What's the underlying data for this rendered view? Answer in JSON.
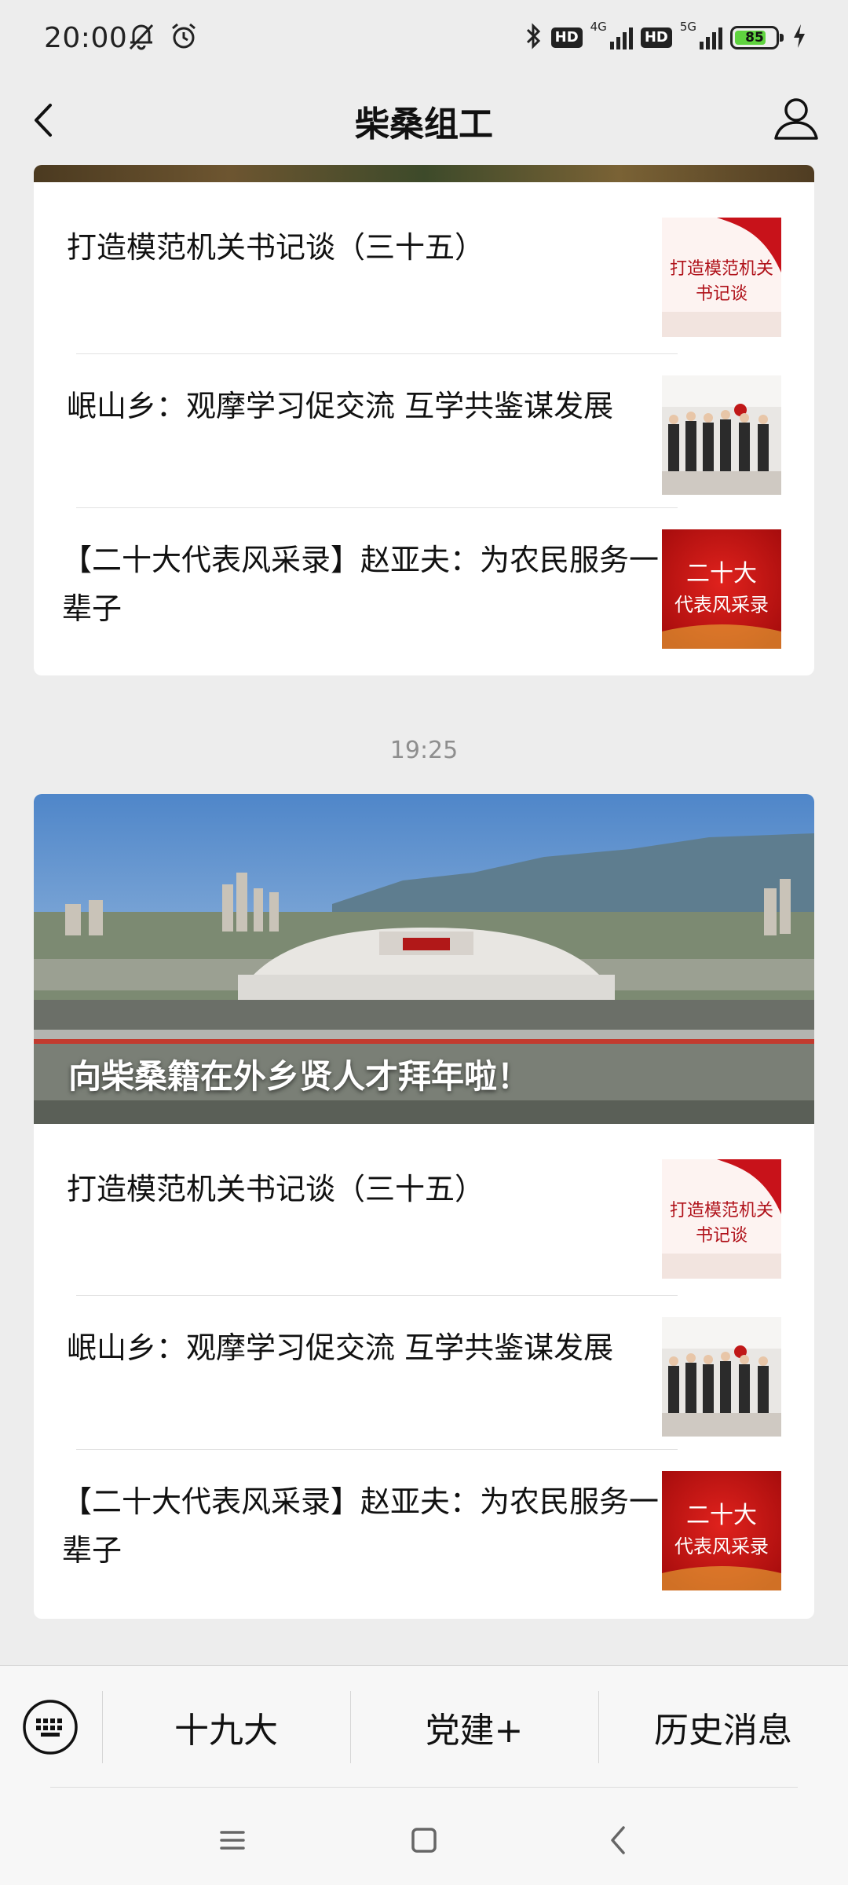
{
  "status_bar": {
    "time": "20:00",
    "icons": [
      "mute-vibrate-icon",
      "alarm-icon",
      "bluetooth-icon"
    ],
    "hd1": "HD",
    "net1": "4G",
    "hd2": "HD",
    "net2": "5G",
    "battery_level": "85"
  },
  "header": {
    "title": "柴桑组工",
    "back_icon": "chevron-left-icon",
    "profile_icon": "person-icon"
  },
  "card1": {
    "items": [
      {
        "title": "打造模范机关书记谈（三十五）",
        "thumb": {
          "line1": "打造模范机关",
          "line2": "书记谈"
        }
      },
      {
        "title": "岷山乡：观摩学习促交流 互学共鉴谋发展"
      },
      {
        "title": "【二十大代表风采录】赵亚夫：为农民服务一辈子",
        "thumb": {
          "line1": "二十大",
          "line2": "代表风采录"
        }
      }
    ]
  },
  "timestamp": "19:25",
  "card2": {
    "cover_title": "向柴桑籍在外乡贤人才拜年啦！",
    "items": [
      {
        "title": "打造模范机关书记谈（三十五）",
        "thumb": {
          "line1": "打造模范机关",
          "line2": "书记谈"
        }
      },
      {
        "title": "岷山乡：观摩学习促交流 互学共鉴谋发展"
      },
      {
        "title": "【二十大代表风采录】赵亚夫：为农民服务一辈子",
        "thumb": {
          "line1": "二十大",
          "line2": "代表风采录"
        }
      }
    ]
  },
  "bottom_menu": {
    "keyboard_icon": "keyboard-icon",
    "items": [
      "十九大",
      "党建+",
      "历史消息"
    ]
  },
  "system_nav": [
    "menu-icon",
    "home-icon",
    "back-icon"
  ],
  "colors": {
    "background": "#ededed",
    "battery": "#5fd33f",
    "thumb_red": "#c8121a"
  }
}
